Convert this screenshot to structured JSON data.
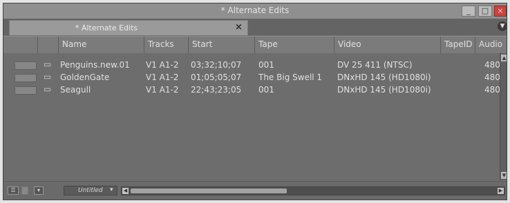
{
  "window": {
    "title": "* Alternate Edits",
    "minimize_icon": "minimize-icon",
    "maximize_icon": "maximize-icon",
    "close_icon": "close-icon"
  },
  "tab": {
    "label": "* Alternate Edits",
    "close_label": "×",
    "menu_icon": "tab-menu-icon"
  },
  "columns": [
    "Name",
    "Tracks",
    "Start",
    "Tape",
    "Video",
    "TapeID",
    "Audio"
  ],
  "rows": [
    {
      "name": "Penguins.new.01",
      "tracks": "V1 A1-2",
      "start": "03;32;10;07",
      "tape": "001",
      "video": "DV 25 411 (NTSC)",
      "audio": "480"
    },
    {
      "name": "GoldenGate",
      "tracks": "V1 A1-2",
      "start": "01;05;05;07",
      "tape": "The Big Swell 1",
      "video": "DNxHD 145 (HD1080i)",
      "audio": "480"
    },
    {
      "name": "Seagull",
      "tracks": "V1 A1-2",
      "start": "22;43;23;05",
      "tape": "001",
      "video": "DNxHD 145 (HD1080i)",
      "audio": "480"
    }
  ],
  "bottom": {
    "view_name": "Untitled"
  },
  "colors": {
    "window_bg": "#6d6d6d",
    "close_button": "#c9443f",
    "text": "#e0e0e0"
  }
}
